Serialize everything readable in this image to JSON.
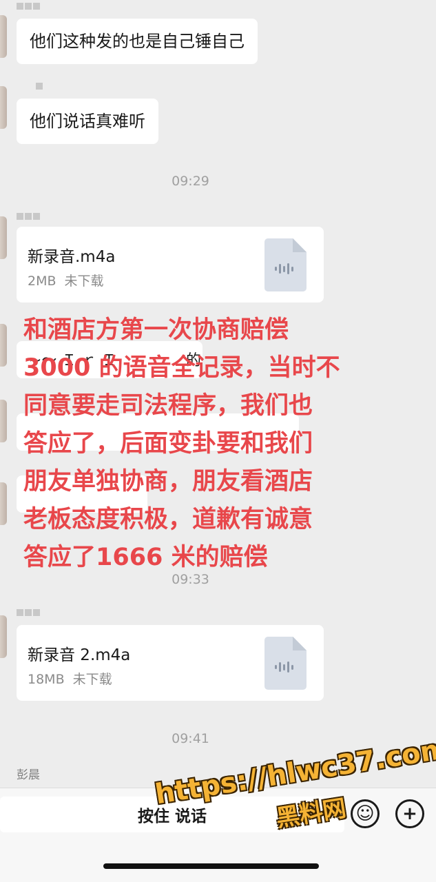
{
  "messages": [
    {
      "text": "他们这种发的也是自己锤自己"
    },
    {
      "text": "他们说话真难听"
    }
  ],
  "timestamps": [
    "09:29",
    "09:33",
    "09:41"
  ],
  "files": [
    {
      "name": "新录音.m4a",
      "size": "2MB",
      "status": "未下载",
      "icon": "audio-file-icon"
    },
    {
      "name": "新录音 2.m4a",
      "size": "18MB",
      "status": "未下载",
      "icon": "audio-file-icon"
    }
  ],
  "obscured_fragments": [
    "~～ Ｉ ｒ Ｉ",
    "的"
  ],
  "overlay_text": [
    "和酒店方第一次协商赔偿",
    "3000 的语音全记录，当时不",
    "同意要走司法程序，我们也",
    "答应了，后面变卦要和我们",
    "朋友单独协商，朋友看酒店",
    "老板态度积极，道歉有诚意",
    "答应了1666 米的赔偿"
  ],
  "last_sender": "彭晨",
  "input_bar": {
    "hold_to_talk": "按住 说话",
    "emoji_icon": "emoji-icon",
    "plus_icon": "plus-icon"
  },
  "watermark": {
    "url": "https://hlwc37.com",
    "name": "黑料网"
  },
  "colors": {
    "background": "#ededed",
    "bubble": "#ffffff",
    "overlay_text": "#e8474b",
    "watermark": "#f5b335"
  }
}
